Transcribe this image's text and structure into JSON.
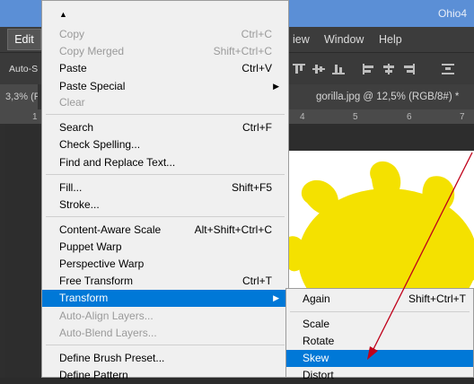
{
  "window": {
    "app_title": "Ohio4"
  },
  "menubar": {
    "edit": "Edit",
    "view": "iew",
    "window": "Window",
    "help": "Help"
  },
  "options_bar": {
    "auto_select": "Auto-S"
  },
  "tabs": {
    "left": "3,3% (F",
    "close": "×",
    "active": "gorilla.jpg @ 12,5% (RGB/8#) *",
    "active_close": "×"
  },
  "ruler": {
    "ticks": [
      "1",
      "4",
      "5",
      "6",
      "7"
    ]
  },
  "edit_menu": {
    "items": [
      {
        "label": "Copy",
        "shortcut": "Ctrl+C",
        "disabled": true
      },
      {
        "label": "Copy Merged",
        "shortcut": "Shift+Ctrl+C",
        "disabled": true
      },
      {
        "label": "Paste",
        "shortcut": "Ctrl+V",
        "disabled": false
      },
      {
        "label": "Paste Special",
        "shortcut": "",
        "disabled": false,
        "submenu": true
      },
      {
        "label": "Clear",
        "shortcut": "",
        "disabled": true
      },
      {
        "label": "Search",
        "shortcut": "Ctrl+F",
        "disabled": false
      },
      {
        "label": "Check Spelling...",
        "shortcut": "",
        "disabled": false
      },
      {
        "label": "Find and Replace Text...",
        "shortcut": "",
        "disabled": false
      },
      {
        "label": "Fill...",
        "shortcut": "Shift+F5",
        "disabled": false
      },
      {
        "label": "Stroke...",
        "shortcut": "",
        "disabled": false
      },
      {
        "label": "Content-Aware Scale",
        "shortcut": "Alt+Shift+Ctrl+C",
        "disabled": false
      },
      {
        "label": "Puppet Warp",
        "shortcut": "",
        "disabled": false
      },
      {
        "label": "Perspective Warp",
        "shortcut": "",
        "disabled": false
      },
      {
        "label": "Free Transform",
        "shortcut": "Ctrl+T",
        "disabled": false
      },
      {
        "label": "Transform",
        "shortcut": "",
        "disabled": false,
        "submenu": true,
        "highlighted": true
      },
      {
        "label": "Auto-Align Layers...",
        "shortcut": "",
        "disabled": true
      },
      {
        "label": "Auto-Blend Layers...",
        "shortcut": "",
        "disabled": true
      },
      {
        "label": "Define Brush Preset...",
        "shortcut": "",
        "disabled": false
      },
      {
        "label": "Define Pattern",
        "shortcut": "",
        "disabled": false
      }
    ]
  },
  "transform_submenu": {
    "items": [
      {
        "label": "Again",
        "shortcut": "Shift+Ctrl+T"
      },
      {
        "label": "Scale",
        "shortcut": ""
      },
      {
        "label": "Rotate",
        "shortcut": ""
      },
      {
        "label": "Skew",
        "shortcut": "",
        "highlighted": true
      },
      {
        "label": "Distort",
        "shortcut": ""
      }
    ]
  },
  "colors": {
    "highlight": "#0078d7",
    "annotation_arrow": "#c0001a",
    "sun_yellow": "#f4e100"
  }
}
